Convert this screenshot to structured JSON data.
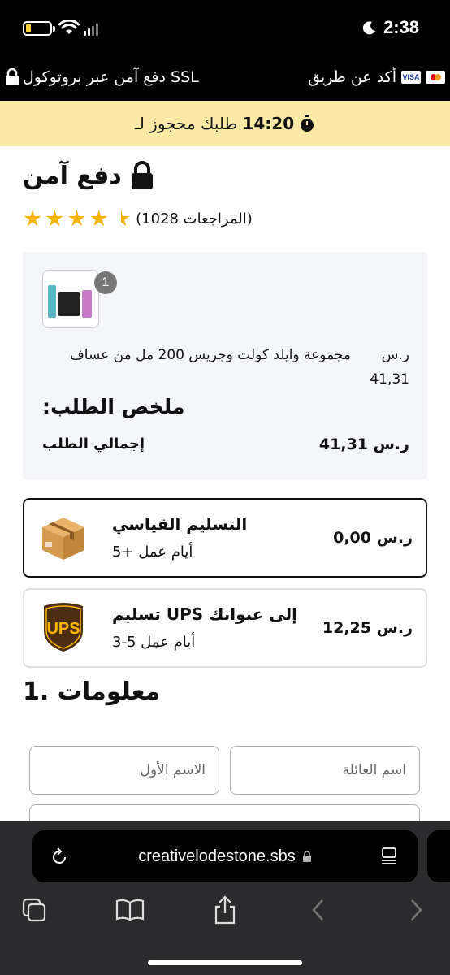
{
  "status": {
    "time": "2:38"
  },
  "ssl_bar": {
    "left_text": "SSL دفع آمن عبر بروتوكول",
    "right_text": "أكد عن طريق",
    "card_label": "VISA"
  },
  "timer": {
    "text": "طلبك محجوز لـ",
    "time": "14:20"
  },
  "page": {
    "title": "دفع آمن",
    "reviews": "(المراجعات 1028)",
    "rating": 4.5
  },
  "order": {
    "item_count": "1",
    "product_name": "مجموعة وايلد كولت وجريس 200 مل من عساف",
    "currency": "ر.س",
    "product_price": "41,31",
    "summary_title": "ملخص الطلب:",
    "total_label": "إجمالي الطلب",
    "total_value": "41,31 ر.س"
  },
  "shipping": [
    {
      "name": "التسليم القياسي",
      "days": "أيام عمل +5",
      "price": "ر.س 0,00"
    },
    {
      "name": "إلى عنوانك UPS تسليم",
      "days": "أيام عمل 5-3",
      "price": "ر.س 12,25",
      "logo": "UPS"
    }
  ],
  "form": {
    "section_title": "معلومات .1",
    "first_name_placeholder": "الاسم الأول",
    "last_name_placeholder": "اسم العائلة"
  },
  "browser": {
    "url": "creativelodestone.sbs"
  },
  "colors": {
    "timer_bg": "#fbe9a6",
    "star": "#f4b400",
    "ups_brown": "#4b2e10",
    "ups_gold": "#ffb500"
  }
}
